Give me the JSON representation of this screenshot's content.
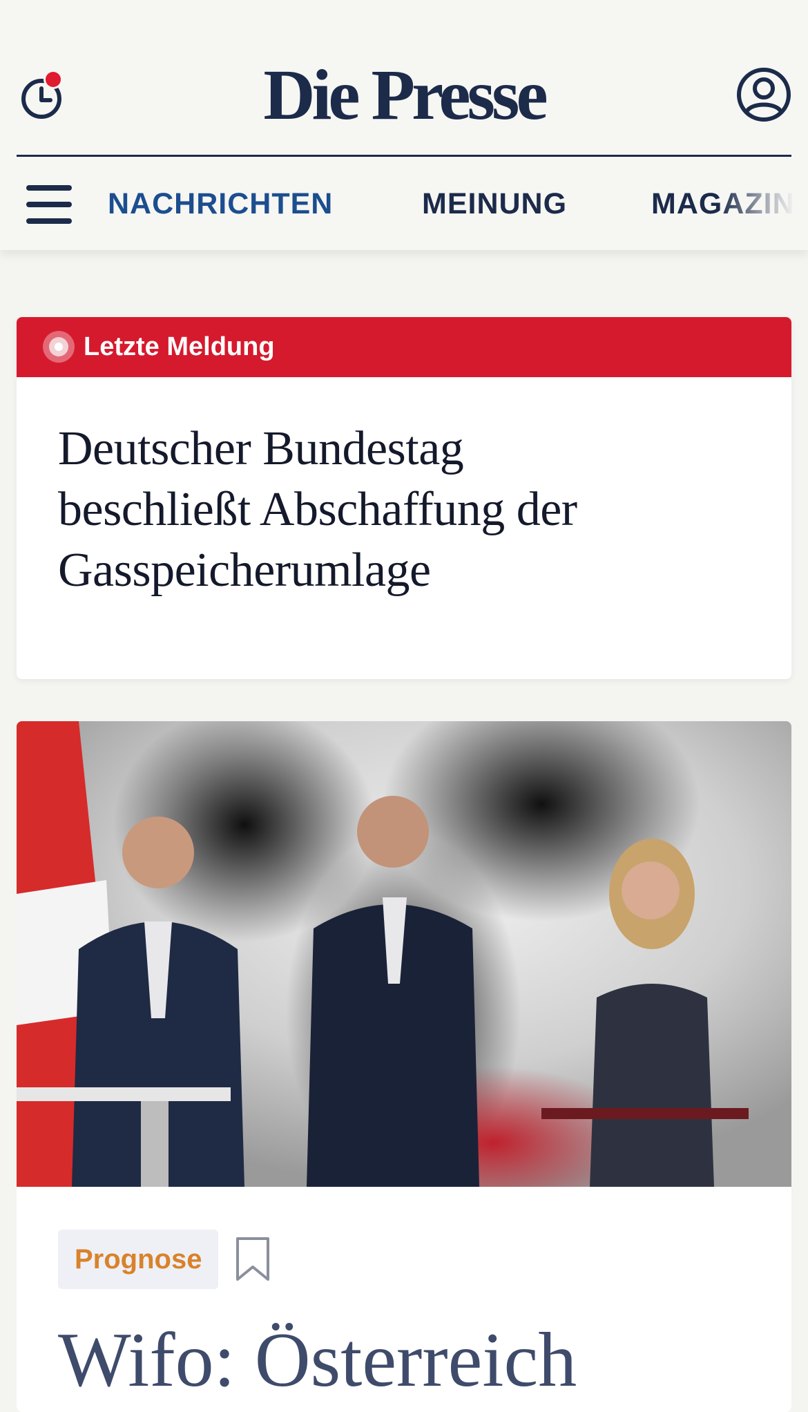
{
  "header": {
    "logo_text": "Die Presse",
    "history_icon": "clock-history-icon",
    "profile_icon": "user-profile-icon",
    "notification_color": "#e01a2f",
    "brand_color": "#1c2b4a"
  },
  "nav": {
    "menu_icon": "hamburger-menu-icon",
    "items": [
      {
        "label": "NACHRICHTEN",
        "active": true
      },
      {
        "label": "MEINUNG",
        "active": false
      },
      {
        "label": "MAGAZIN",
        "active": false
      }
    ]
  },
  "breaking": {
    "label": "Letzte Meldung",
    "headline": "Deutscher Bundestag beschließt Abschaffung der Gasspeicherumlage",
    "bar_color": "#d51a2e"
  },
  "article": {
    "image_icon": "press-conference-photo",
    "tag": "Prognose",
    "tag_color": "#d9822b",
    "bookmark_icon": "bookmark-icon",
    "headline": "Wifo: Österreich"
  }
}
